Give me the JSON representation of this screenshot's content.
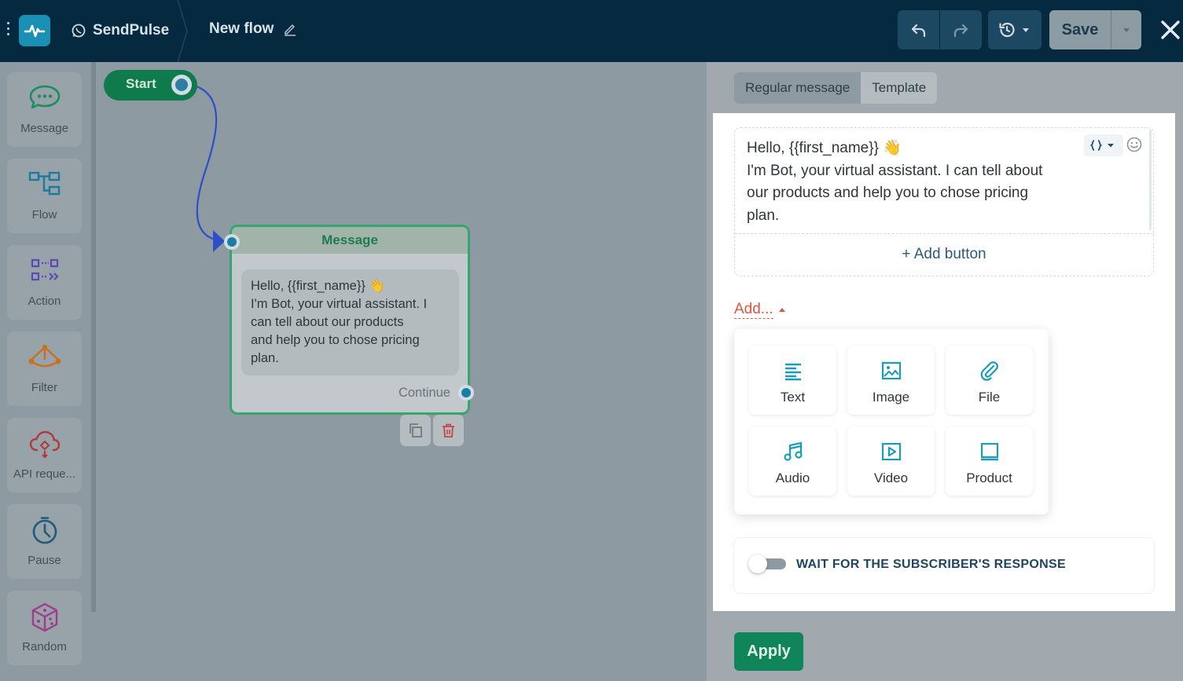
{
  "header": {
    "brand": "SendPulse",
    "flow_title": "New flow",
    "save_label": "Save",
    "icons": [
      "menu-icon",
      "pulse-logo-icon",
      "whatsapp-icon",
      "edit-icon",
      "undo-icon",
      "redo-icon",
      "history-icon",
      "close-icon"
    ]
  },
  "sidebar": {
    "items": [
      {
        "label": "Message",
        "icon": "message-icon",
        "color": "#1a8f5c"
      },
      {
        "label": "Flow",
        "icon": "flow-icon",
        "color": "#1c7aa1"
      },
      {
        "label": "Action",
        "icon": "action-icon",
        "color": "#5c4bb0"
      },
      {
        "label": "Filter",
        "icon": "filter-icon",
        "color": "#c8701e"
      },
      {
        "label": "API reque...",
        "icon": "cloud-api-icon",
        "color": "#b03a3a"
      },
      {
        "label": "Pause",
        "icon": "clock-icon",
        "color": "#1f5b7a"
      },
      {
        "label": "Random",
        "icon": "dice-icon",
        "color": "#a03c8a"
      }
    ]
  },
  "canvas": {
    "start_label": "Start",
    "message_node": {
      "title": "Message",
      "lines": [
        "Hello, {{first_name}} 👋",
        "I'm Bot, your virtual assistant. I",
        "can tell about our products",
        "and help you to chose pricing",
        "plan."
      ],
      "continue_label": "Continue"
    }
  },
  "panel": {
    "tabs": [
      {
        "label": "Regular message",
        "active": true
      },
      {
        "label": "Template",
        "active": false
      }
    ],
    "editor": {
      "lines": [
        "Hello, {{first_name}} 👋",
        "I'm Bot, your virtual assistant. I can tell about",
        "our products and help you to chose pricing",
        "plan."
      ],
      "add_button_label": "+ Add button"
    },
    "add_menu_label": "Add...",
    "add_options": [
      {
        "label": "Text",
        "icon": "text-icon"
      },
      {
        "label": "Image",
        "icon": "image-icon"
      },
      {
        "label": "File",
        "icon": "paperclip-icon"
      },
      {
        "label": "Audio",
        "icon": "music-icon"
      },
      {
        "label": "Video",
        "icon": "video-icon"
      },
      {
        "label": "Product",
        "icon": "product-icon"
      }
    ],
    "wait_toggle_label": "WAIT FOR THE SUBSCRIBER'S RESPONSE",
    "wait_toggle_on": false,
    "apply_label": "Apply"
  },
  "colors": {
    "header_bg": "#05293e",
    "accent_green": "#11855a",
    "node_border": "#36a56f",
    "add_link": "#e0553e",
    "icon_teal": "#1a9bb8"
  }
}
